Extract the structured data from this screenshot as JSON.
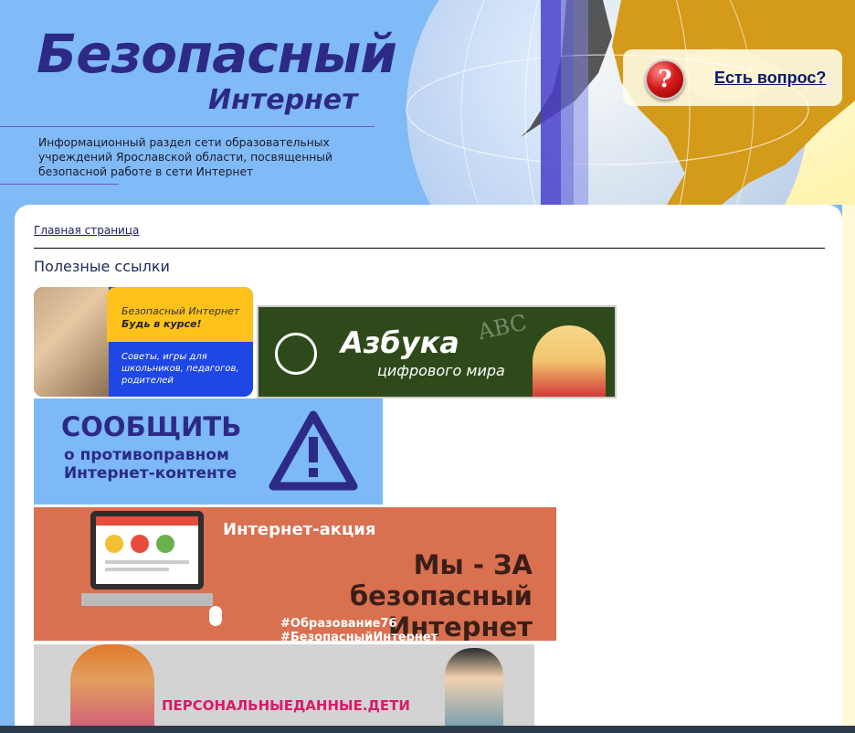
{
  "header": {
    "logo_title": "Безопасный",
    "logo_subtitle": "Интернет",
    "description": "Информационный раздел сети образовательных учреждений Ярославской области, посвященный безопасной работе в сети Интернет",
    "question_link": "Есть вопрос?"
  },
  "breadcrumb": {
    "home": "Главная страница"
  },
  "section_title": "Полезные ссылки",
  "banners": {
    "b1": {
      "line1": "Безопасный Интернет",
      "line2": "Будь в курсе!",
      "line3": "Советы, игры для школьников, педагогов, родителей"
    },
    "b2": {
      "title": "Азбука",
      "subtitle": "цифрового мира",
      "abc": "ABC"
    },
    "b3": {
      "title": "СООБЩИТЬ",
      "subtitle": "о противоправном Интернет-контенте"
    },
    "b4": {
      "kicker": "Интернет-акция",
      "title": "Мы - ЗА безопасный Интернет",
      "tags": "#Образование76   #БезопасныйИнтернет"
    },
    "b5": {
      "text": "ПЕРСОНАЛЬНЫЕДАННЫЕ.ДЕТИ"
    }
  },
  "colors": {
    "header_bg": "#80baf7",
    "logo": "#2d2a86",
    "globe_gold": "#d49a1a"
  }
}
